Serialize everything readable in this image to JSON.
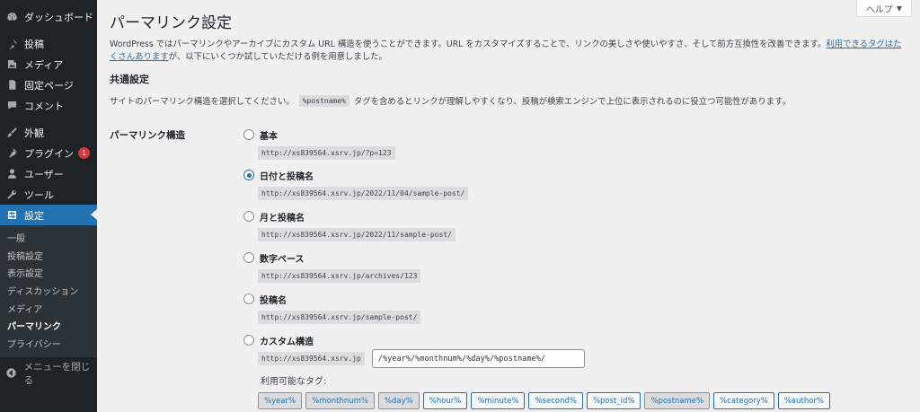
{
  "sidebar": {
    "items": [
      {
        "label": "ダッシュボード",
        "icon": "dashboard-icon"
      },
      {
        "label": "投稿",
        "icon": "pin-icon"
      },
      {
        "label": "メディア",
        "icon": "media-icon"
      },
      {
        "label": "固定ページ",
        "icon": "page-icon"
      },
      {
        "label": "コメント",
        "icon": "comment-icon"
      },
      {
        "label": "外観",
        "icon": "brush-icon"
      },
      {
        "label": "プラグイン",
        "icon": "plugin-icon",
        "badge": "1"
      },
      {
        "label": "ユーザー",
        "icon": "user-icon"
      },
      {
        "label": "ツール",
        "icon": "wrench-icon"
      },
      {
        "label": "設定",
        "icon": "settings-icon"
      }
    ],
    "submenu": [
      "一般",
      "投稿設定",
      "表示設定",
      "ディスカッション",
      "メディア",
      "パーマリンク",
      "プライバシー"
    ],
    "collapse_label": "メニューを閉じる"
  },
  "header": {
    "title": "パーマリンク設定",
    "help_label": "ヘルプ"
  },
  "intro": {
    "text": "WordPress ではパーマリンクやアーカイブにカスタム URL 構造を使うことができます。URL をカスタマイズすることで、リンクの美しさや使いやすさ、そして前方互換性を改善できます。",
    "link": "利用できるタグはたくさんあります",
    "text2": "が、以下にいくつか試していただける例を用意しました。"
  },
  "common": {
    "title": "共通設定",
    "desc_before": "サイトのパーマリンク構造を選択してください。",
    "desc_code": "%postname%",
    "desc_after": "タグを含めるとリンクが理解しやすくなり、投稿が検索エンジンで上位に表示されるのに役立つ可能性があります。",
    "row_label": "パーマリンク構造"
  },
  "options": [
    {
      "label": "基本",
      "example": "http://xs839564.xsrv.jp/?p=123",
      "checked": false
    },
    {
      "label": "日付と投稿名",
      "example": "http://xs839564.xsrv.jp/2022/11/04/sample-post/",
      "checked": true
    },
    {
      "label": "月と投稿名",
      "example": "http://xs839564.xsrv.jp/2022/11/sample-post/",
      "checked": false
    },
    {
      "label": "数字ベース",
      "example": "http://xs839564.xsrv.jp/archives/123",
      "checked": false
    },
    {
      "label": "投稿名",
      "example": "http://xs839564.xsrv.jp/sample-post/",
      "checked": false
    },
    {
      "label": "カスタム構造",
      "checked": false
    }
  ],
  "custom": {
    "prefix": "http://xs839564.xsrv.jp",
    "value": "/%year%/%monthnum%/%day%/%postname%/",
    "tags_label": "利用可能なタグ:",
    "tags": [
      {
        "label": "%year%",
        "active": true
      },
      {
        "label": "%monthnum%",
        "active": true
      },
      {
        "label": "%day%",
        "active": true
      },
      {
        "label": "%hour%",
        "active": false
      },
      {
        "label": "%minute%",
        "active": false
      },
      {
        "label": "%second%",
        "active": false
      },
      {
        "label": "%post_id%",
        "active": false
      },
      {
        "label": "%postname%",
        "active": true
      },
      {
        "label": "%category%",
        "active": false
      },
      {
        "label": "%author%",
        "active": false
      }
    ]
  },
  "colors": {
    "accent": "#2271b1",
    "sidebar_bg": "#1d2327",
    "badge": "#d63638"
  }
}
